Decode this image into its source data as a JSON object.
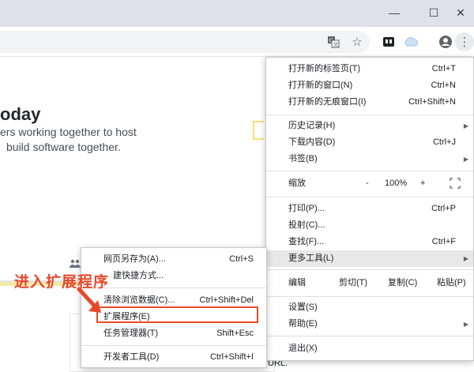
{
  "window": {
    "minimize": "—",
    "maximize": "☐",
    "close": "✕"
  },
  "toolbar": {
    "translate_icon": "translate-icon",
    "star_icon": "star-icon",
    "extension_icon": "extension-icon",
    "cloud_icon": "cloud-icon",
    "profile_icon": "profile-icon",
    "menu_icon": "menu-dots-icon"
  },
  "page": {
    "title_fragment": "oday",
    "subtitle_line1": "ers working together to host",
    "subtitle_line2": "build software together.",
    "bottom_text": "URL."
  },
  "main_menu": {
    "items": [
      {
        "label": "打开新的标签页(T)",
        "shortcut": "Ctrl+T"
      },
      {
        "label": "打开新的窗口(N)",
        "shortcut": "Ctrl+N"
      },
      {
        "label": "打开新的无痕窗口(I)",
        "shortcut": "Ctrl+Shift+N"
      },
      {
        "label": "历史记录(H)",
        "shortcut": ""
      },
      {
        "label": "下载内容(D)",
        "shortcut": "Ctrl+J"
      },
      {
        "label": "书签(B)",
        "shortcut": ""
      },
      {
        "label": "打印(P)...",
        "shortcut": "Ctrl+P"
      },
      {
        "label": "投射(C)...",
        "shortcut": ""
      },
      {
        "label": "查找(F)...",
        "shortcut": "Ctrl+F"
      },
      {
        "label": "更多工具(L)",
        "shortcut": ""
      },
      {
        "label": "设置(S)",
        "shortcut": ""
      },
      {
        "label": "帮助(E)",
        "shortcut": ""
      },
      {
        "label": "退出(X)",
        "shortcut": ""
      }
    ],
    "zoom": {
      "label": "缩放",
      "minus": "-",
      "value": "100%",
      "plus": "+"
    },
    "edit": {
      "label": "编辑",
      "cut": "剪切(T)",
      "copy": "复制(C)",
      "paste": "粘贴(P)"
    }
  },
  "sub_menu": {
    "items": [
      {
        "label": "网页另存为(A)...",
        "shortcut": "Ctrl+S"
      },
      {
        "label": "建快捷方式...",
        "shortcut": ""
      },
      {
        "label": "清除浏览数据(C)...",
        "shortcut": "Ctrl+Shift+Del"
      },
      {
        "label": "扩展程序(E)",
        "shortcut": ""
      },
      {
        "label": "任务管理器(T)",
        "shortcut": "Shift+Esc"
      },
      {
        "label": "开发者工具(D)",
        "shortcut": "Ctrl+Shift+I"
      }
    ]
  },
  "annotation": {
    "callout": "进入扩展程序",
    "accent_color": "#e8492b"
  }
}
